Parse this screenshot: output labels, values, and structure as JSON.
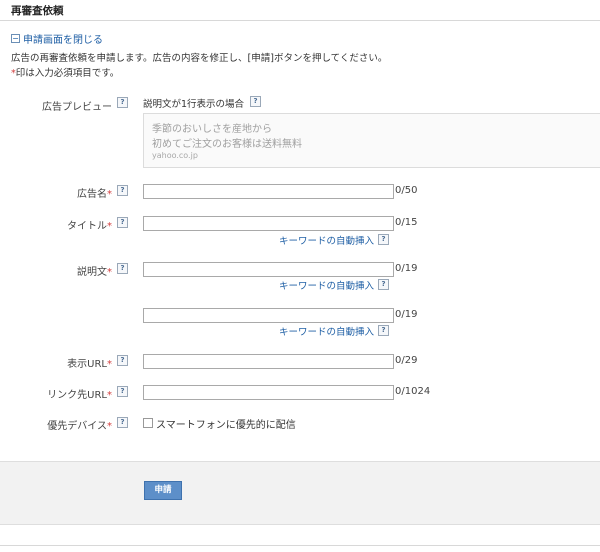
{
  "page": {
    "title": "再審査依頼",
    "toggle_label": "申請画面を閉じる",
    "toggle_icon": "minus-square-icon",
    "instruction": "広告の再審査依頼を申請します。広告の内容を修正し、[申請]ボタンを押してください。",
    "required_mark": "*",
    "required_note": "印は入力必須項目です。"
  },
  "preview": {
    "label": "広告プレビュー",
    "heading": "説明文が1行表示の場合",
    "line1": "季節のおいしさを産地から",
    "line2": "初めてご注文のお客様は送料無料",
    "url": "yahoo.co.jp"
  },
  "help_icon_text": "?",
  "fields": {
    "ad_name": {
      "label": "広告名",
      "value": "",
      "count": "0/50"
    },
    "title": {
      "label": "タイトル",
      "value": "",
      "count": "0/15",
      "keyword_link": "キーワードの自動挿入"
    },
    "description1": {
      "label": "説明文",
      "value": "",
      "count": "0/19",
      "keyword_link": "キーワードの自動挿入"
    },
    "description2": {
      "value": "",
      "count": "0/19",
      "keyword_link": "キーワードの自動挿入"
    },
    "display_url": {
      "label": "表示URL",
      "value": "",
      "count": "0/29"
    },
    "link_url": {
      "label": "リンク先URL",
      "value": "",
      "count": "0/1024"
    },
    "device": {
      "label": "優先デバイス",
      "checkbox_label": "スマートフォンに優先的に配信",
      "checked": false
    }
  },
  "submit_label": "申請",
  "colors": {
    "link": "#1f5fa5",
    "required": "#d23c3c",
    "button": "#5d8fc9"
  }
}
